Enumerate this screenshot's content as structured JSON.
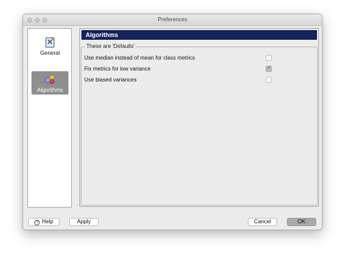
{
  "window": {
    "title": "Preferences"
  },
  "sidebar": {
    "items": [
      {
        "label": "General",
        "icon": "general-settings-icon",
        "selected": false
      },
      {
        "label": "Algorithms",
        "icon": "algorithms-icon",
        "selected": true
      }
    ]
  },
  "panel": {
    "title": "Algorithms",
    "group_title": "These are 'Defaults'",
    "options": [
      {
        "label": "Use median instead of mean for class metrics",
        "checked": false
      },
      {
        "label": "Fix metrics for low variance",
        "checked": true
      },
      {
        "label": "Use biased variances",
        "checked": false
      }
    ]
  },
  "buttons": {
    "help": "Help",
    "apply": "Apply",
    "cancel": "Cancel",
    "ok": "OK"
  },
  "colors": {
    "header_bar": "#13245e",
    "selected_item": "#8f8f8f"
  }
}
